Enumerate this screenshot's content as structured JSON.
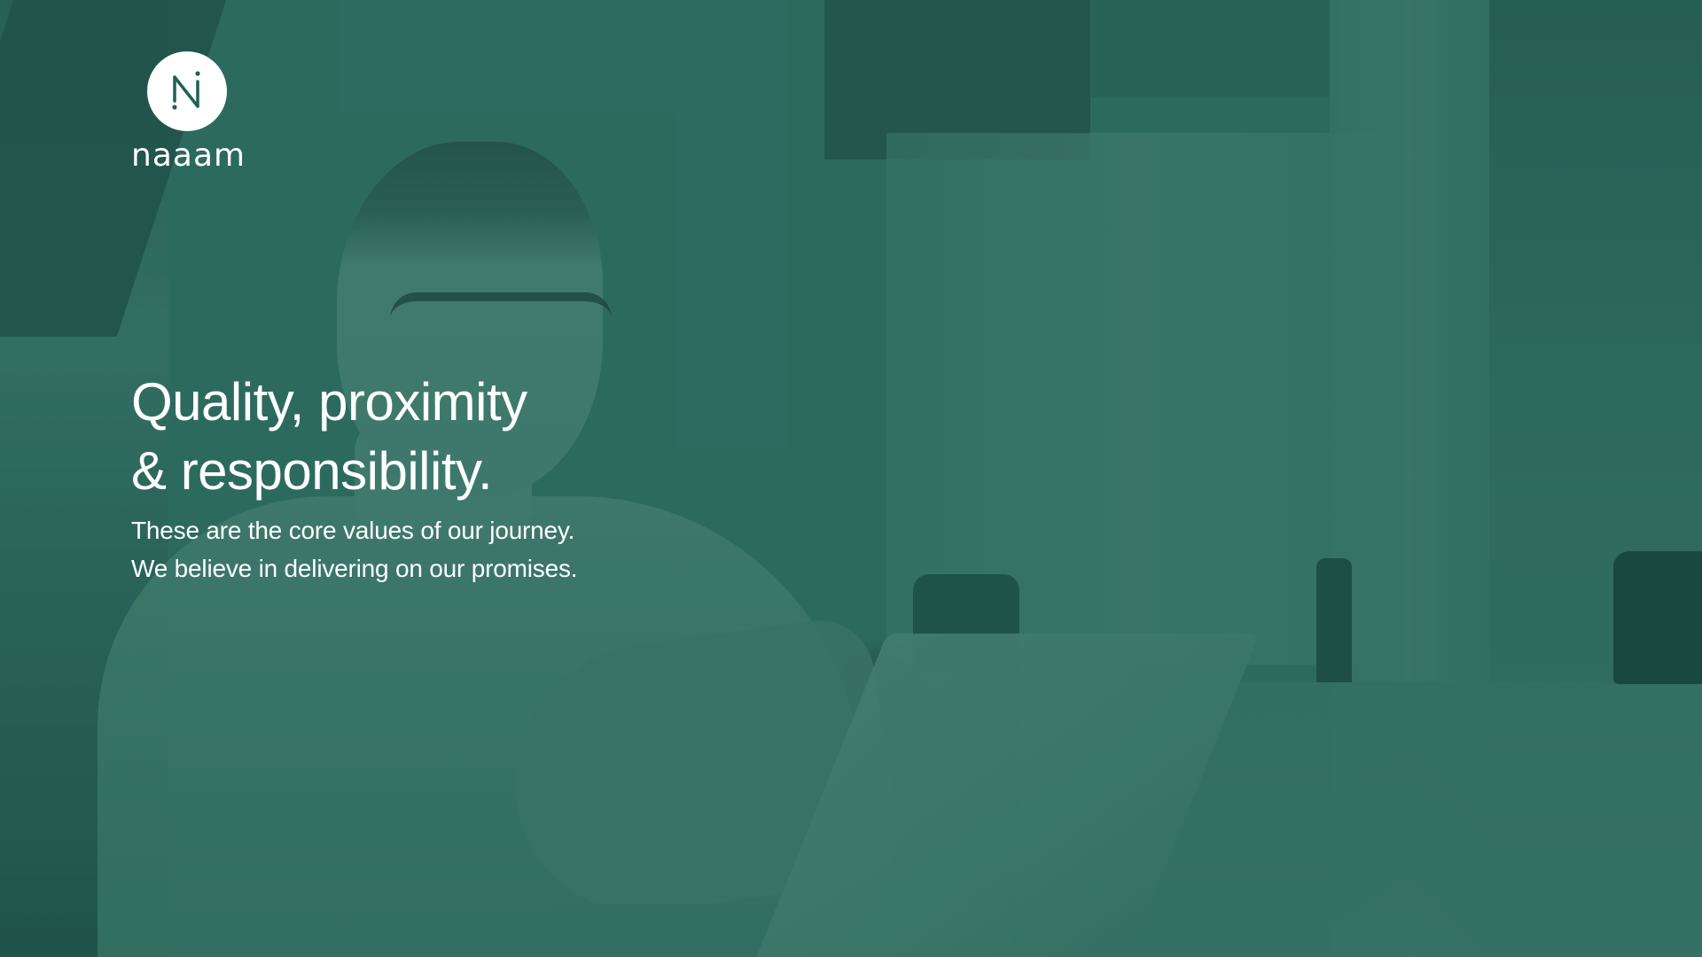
{
  "brand": {
    "logo_letter": "N",
    "name": "naaam",
    "logo_icon": "naaam-logo-icon"
  },
  "hero": {
    "title_line1": "Quality, proximity",
    "title_line2": "& responsibility.",
    "subtitle_line1": "These are the core values of our journey.",
    "subtitle_line2": "We believe in delivering on our promises."
  },
  "colors": {
    "overlay_green": "#2f6b60",
    "text": "#ffffff",
    "logo_mark": "#1f6156"
  }
}
